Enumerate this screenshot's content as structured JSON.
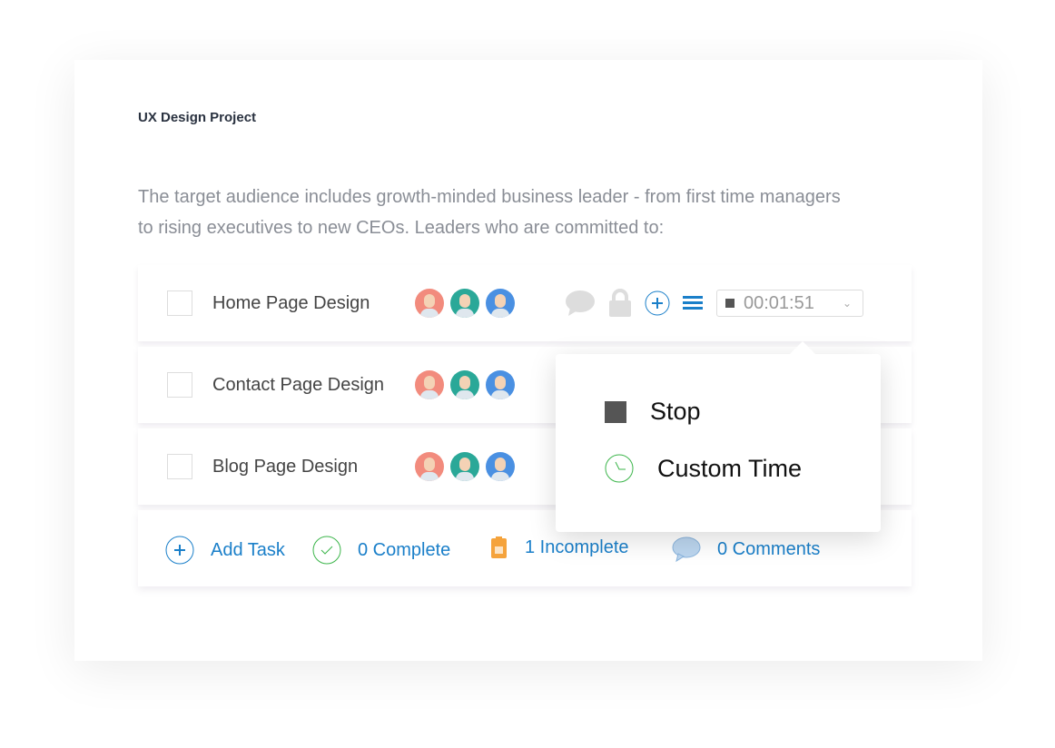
{
  "project_title": "UX Design Project",
  "description": "The target audience includes growth-minded business leader - from first time managers to rising executives to new CEOs. Leaders who are committed to:",
  "tasks": [
    {
      "name": "Home Page Design"
    },
    {
      "name": "Contact Page Design"
    },
    {
      "name": "Blog Page Design"
    }
  ],
  "avatar_colors": [
    "#f28b7d",
    "#2aa898",
    "#4a90e2"
  ],
  "timer": {
    "value": "00:01:51"
  },
  "popup": {
    "stop": "Stop",
    "custom_time": "Custom Time"
  },
  "footer": {
    "add_task": "Add Task",
    "complete": "0 Complete",
    "incomplete": "1 Incomplete",
    "comments": "0 Comments"
  },
  "colors": {
    "accent": "#1a7fc9",
    "complete": "#3bb54a",
    "incomplete": "#f5a33c"
  }
}
